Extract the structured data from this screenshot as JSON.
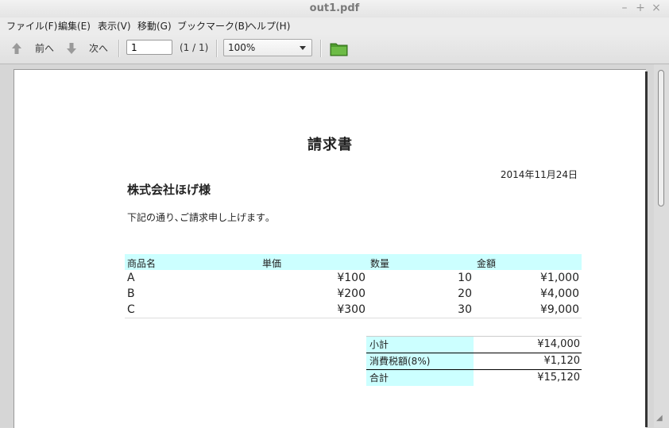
{
  "window": {
    "title": "out1.pdf",
    "minimize": "–",
    "maximize": "+",
    "close": "×"
  },
  "menu": [
    "ファイル(F)",
    "編集(E)",
    "表示(V)",
    "移動(G)",
    "ブックマーク(B)",
    "ヘルプ(H)"
  ],
  "toolbar": {
    "prev_label": "前へ",
    "next_label": "次へ",
    "page_value": "1",
    "page_count": "(1 / 1)",
    "zoom_value": "100%"
  },
  "document": {
    "title": "請求書",
    "date": "2014年11月24日",
    "client": "株式会社ほげ様",
    "intro": "下記の通り､ご請求申し上げます｡",
    "headers": [
      "商品名",
      "単価",
      "数量",
      "金額"
    ],
    "rows": [
      [
        "A",
        "¥100",
        "10",
        "¥1,000"
      ],
      [
        "B",
        "¥200",
        "20",
        "¥4,000"
      ],
      [
        "C",
        "¥300",
        "30",
        "¥9,000"
      ]
    ],
    "totals": [
      {
        "label": "小計",
        "value": "¥14,000"
      },
      {
        "label": "消費税額(8%)",
        "value": "¥1,120"
      },
      {
        "label": "合計",
        "value": "¥15,120"
      }
    ]
  },
  "colors": {
    "table_header_bg": "#ccffff",
    "folder_green": "#5aa836"
  }
}
